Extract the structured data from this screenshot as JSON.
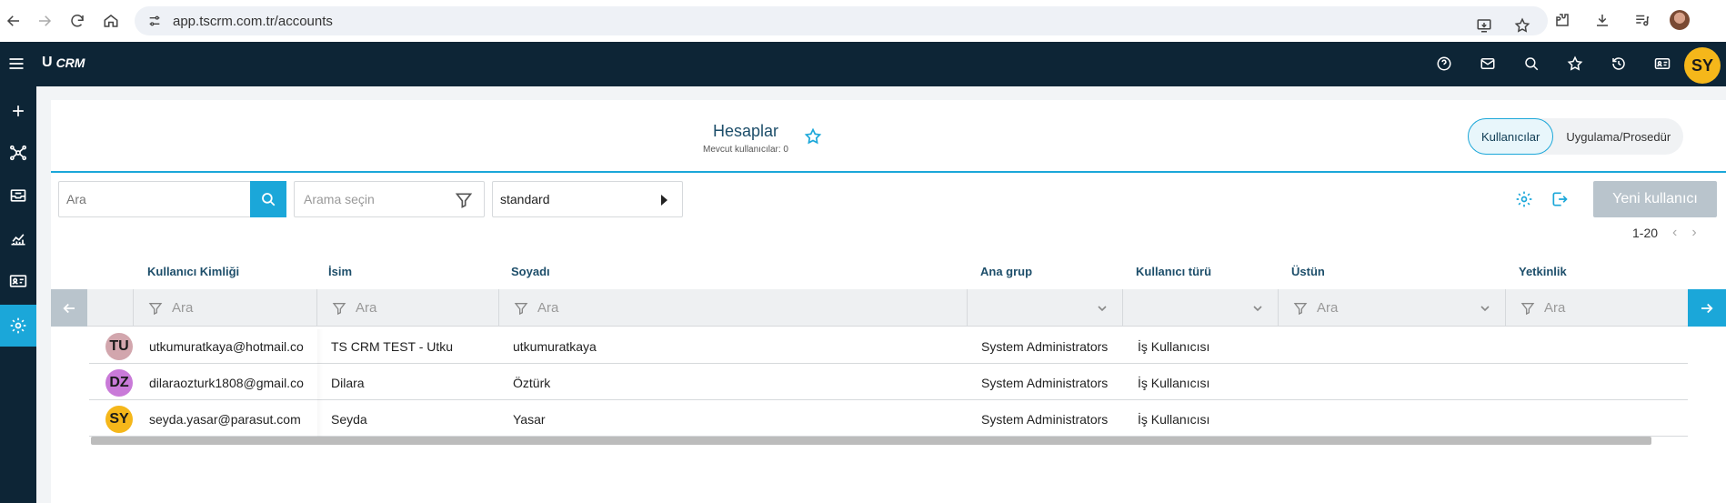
{
  "browser": {
    "url": "app.tscrm.com.tr/accounts"
  },
  "app": {
    "logo_text": "CRM",
    "logo_mark": "U",
    "user_initials": "SY",
    "top_icons": [
      "help-icon",
      "mail-icon",
      "search-icon",
      "star-icon",
      "history-icon",
      "id-card-icon"
    ],
    "accent_color": "#1ba7d9",
    "bar_color": "#0d2536"
  },
  "rail": {
    "items": [
      "menu-icon",
      "plus-icon",
      "network-icon",
      "inbox-icon",
      "analytics-icon",
      "contact-icon",
      "settings-icon"
    ],
    "active": "settings-icon"
  },
  "page": {
    "title": "Hesaplar",
    "subtitle": "Mevcut kullanıcılar: 0",
    "tabs": [
      {
        "label": "Kullanıcılar",
        "active": true
      },
      {
        "label": "Uygulama/Prosedür",
        "active": false
      }
    ]
  },
  "toolbar": {
    "search_placeholder": "Ara",
    "filter_placeholder": "Arama seçin",
    "view_value": "standard",
    "new_button": "Yeni kullanıcı",
    "pager_range": "1-20"
  },
  "table": {
    "columns": [
      "Kullanıcı Kimliği",
      "İsim",
      "Soyadı",
      "Ana grup",
      "Kullanıcı türü",
      "Üstün",
      "Yetkinlik"
    ],
    "filter_placeholder": "Ara",
    "rows": [
      {
        "initials": "TU",
        "avatar_color": "#d2a6ad",
        "id": "utkumuratkaya@hotmail.co",
        "name": "TS CRM TEST - Utku",
        "surname": "utkumuratkaya",
        "group": "System Administrators",
        "type": "İş Kullanıcısı"
      },
      {
        "initials": "DZ",
        "avatar_color": "#c97ad8",
        "id": "dilaraozturk1808@gmail.co",
        "name": "Dilara",
        "surname": "Öztürk",
        "group": "System Administrators",
        "type": "İş Kullanıcısı"
      },
      {
        "initials": "SY",
        "avatar_color": "#f5b71a",
        "id": "seyda.yasar@parasut.com",
        "name": "Seyda",
        "surname": "Yasar",
        "group": "System Administrators",
        "type": "İş Kullanıcısı"
      }
    ]
  }
}
